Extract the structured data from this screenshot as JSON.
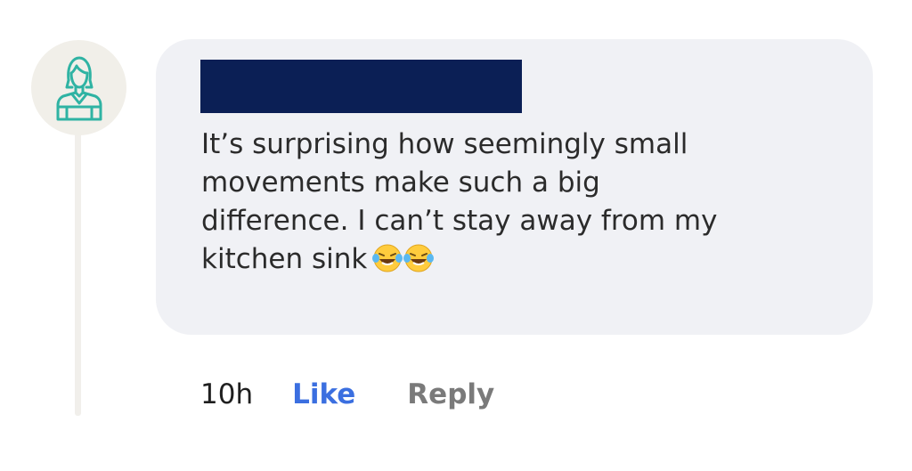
{
  "comment": {
    "author_name_redacted": true,
    "text": "It’s surprising how seemingly small\nmovements make such a big\ndifference. I can’t stay away from my\nkitchen sink",
    "emojis": [
      "😂",
      "😂"
    ]
  },
  "meta": {
    "time_ago": "10h",
    "like_label": "Like",
    "reply_label": "Reply"
  },
  "avatar": {
    "icon": "woman-avatar-icon",
    "color": "#2fb3a3"
  },
  "colors": {
    "bubble": "#f0f1f5",
    "redaction": "#0b1f55",
    "like": "#3b6fe0",
    "reply": "#7a7a7a"
  }
}
